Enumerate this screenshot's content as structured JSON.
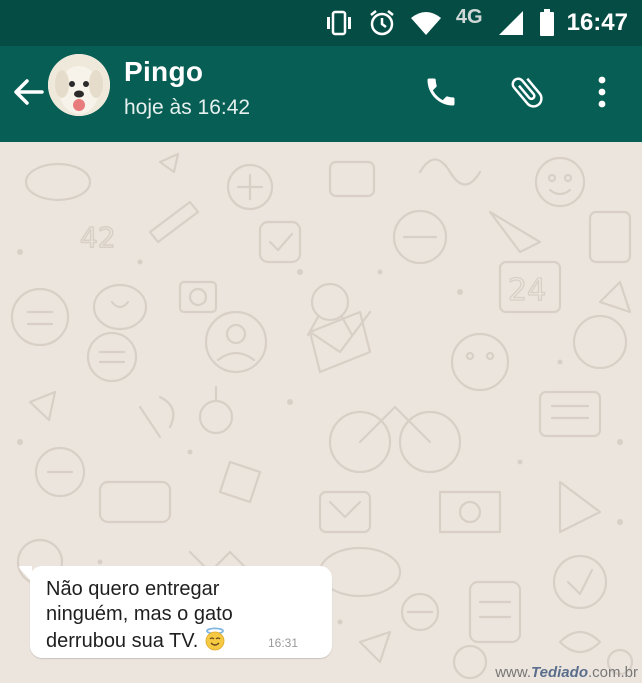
{
  "status_bar": {
    "network": "4G",
    "time": "16:47",
    "icons": [
      "vibrate-icon",
      "alarm-icon",
      "wifi-icon",
      "signal-icon",
      "battery-icon"
    ]
  },
  "header": {
    "contact_name": "Pingo",
    "last_seen": "hoje às 16:42",
    "icons": [
      "back-arrow-icon",
      "avatar",
      "phone-icon",
      "paperclip-icon",
      "more-vert-icon"
    ]
  },
  "messages": [
    {
      "direction": "incoming",
      "lines": [
        "Não quero entregar",
        "ninguém, mas o gato",
        "derrubou sua TV."
      ],
      "emoji": "smiling-face-with-halo",
      "time": "16:31"
    }
  ],
  "watermark": {
    "prefix": "www.",
    "brand": "Tediado",
    "suffix": ".com.br"
  },
  "colors": {
    "status_bar": "#054d44",
    "toolbar": "#075e54",
    "chat_background": "#ece5dd",
    "bubble_incoming": "#ffffff"
  }
}
